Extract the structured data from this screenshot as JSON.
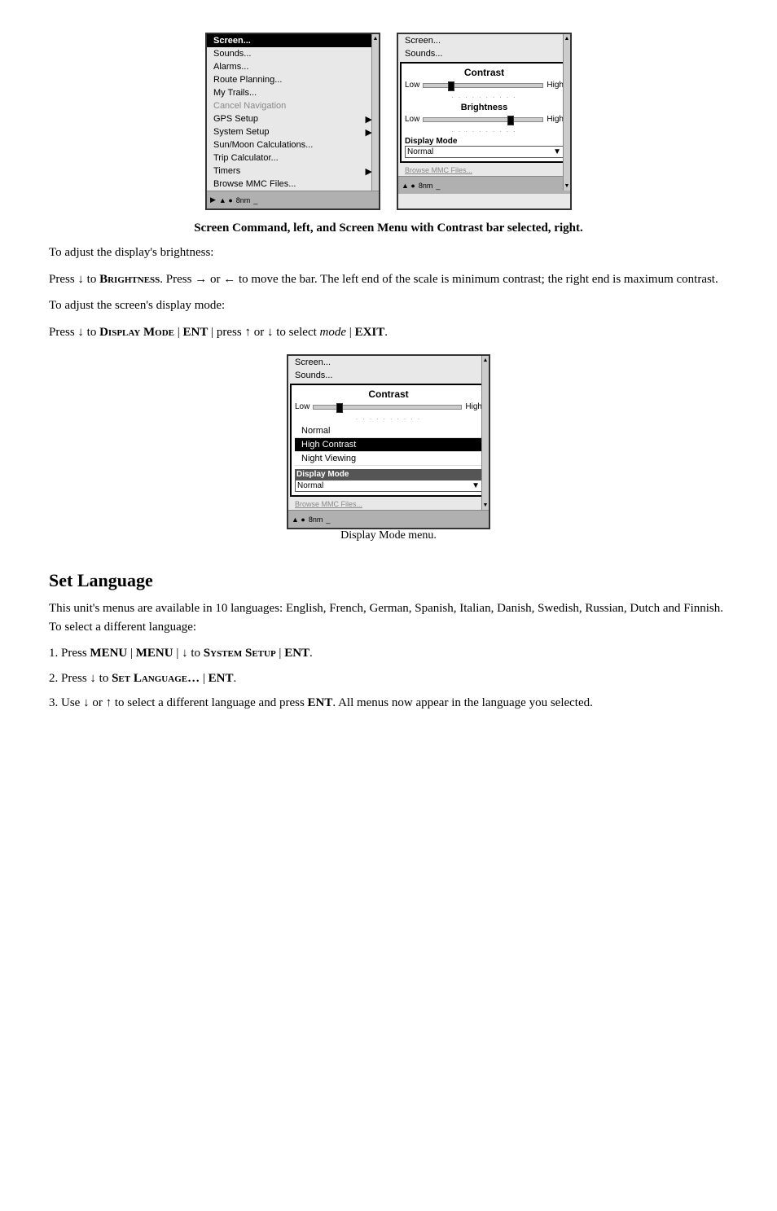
{
  "screenshots": {
    "left_screen": {
      "menu_items": [
        {
          "label": "Screen...",
          "style": "header-like"
        },
        {
          "label": "Sounds...",
          "style": "normal"
        },
        {
          "label": "Alarms...",
          "style": "normal"
        },
        {
          "label": "Route Planning...",
          "style": "normal"
        },
        {
          "label": "My Trails...",
          "style": "normal"
        },
        {
          "label": "Cancel Navigation",
          "style": "disabled"
        },
        {
          "label": "GPS Setup",
          "style": "submenu"
        },
        {
          "label": "System Setup",
          "style": "submenu"
        },
        {
          "label": "Sun/Moon Calculations...",
          "style": "normal"
        },
        {
          "label": "Trip Calculator...",
          "style": "normal"
        },
        {
          "label": "Timers",
          "style": "submenu"
        },
        {
          "label": "Browse MMC Files...",
          "style": "normal"
        }
      ],
      "bottom_label": "8nm"
    },
    "right_screen": {
      "menu_items": [
        {
          "label": "Screen...",
          "style": "normal"
        },
        {
          "label": "Sounds...",
          "style": "normal"
        }
      ],
      "panel_title": "Screen",
      "contrast_label": "Contrast",
      "low_label": "Low",
      "high_label": "High",
      "brightness_label": "Brightness",
      "display_mode_label": "Display Mode",
      "display_mode_value": "Normal",
      "browse_label": "Browse MMC Files...",
      "bottom_label": "8nm"
    }
  },
  "caption_main": "Screen Command, left, and Screen Menu with Contrast bar selected, right.",
  "para1": "To adjust the display's brightness:",
  "para2_prefix": "Press ",
  "para2_down": "↓",
  "para2_text1": " to ",
  "para2_brightness": "Brightness",
  "para2_text2": ". Press ",
  "para2_right": "→",
  "para2_or": " or ",
  "para2_left": "←",
  "para2_text3": " to move the bar. The left end of the scale is minimum contrast; the right end is maximum contrast.",
  "para3": "To adjust the screen's display mode:",
  "para4_prefix": "Press ",
  "para4_down": "↓",
  "para4_text1": " to ",
  "para4_display_mode": "Display Mode",
  "para4_pipe1": " | ",
  "para4_ent": "ENT",
  "para4_pipe2": " | press ",
  "para4_up": "↑",
  "para4_or": " or ",
  "para4_down2": "↓",
  "para4_text2": " to select ",
  "para4_mode_italic": "mode",
  "para4_pipe3": " | ",
  "para4_exit": "EXIT",
  "para4_period": ".",
  "display_mode_screen": {
    "menu_items": [
      {
        "label": "Screen...",
        "style": "normal"
      },
      {
        "label": "Sounds...",
        "style": "normal"
      }
    ],
    "panel_title": "Screen",
    "contrast_label": "Contrast",
    "low_label": "Low",
    "high_label": "High",
    "mode_list": [
      {
        "label": "Normal",
        "selected": false
      },
      {
        "label": "High Contrast",
        "selected": false
      },
      {
        "label": "Night Viewing",
        "selected": false
      }
    ],
    "display_mode_label": "Display Mode",
    "display_mode_value": "Normal",
    "browse_label": "Browse MMC Files...",
    "bottom_label": "8nm"
  },
  "display_mode_caption": "Display Mode menu.",
  "section_title": "Set Language",
  "section_para1": "This unit's menus are available in 10 languages: English, French, German, Spanish, Italian, Danish, Swedish, Russian, Dutch and Finnish. To select a different language:",
  "step1_prefix": "1. Press ",
  "step1_menu1": "MENU",
  "step1_pipe1": " | ",
  "step1_menu2": "MENU",
  "step1_pipe2": " | ",
  "step1_down": "↓",
  "step1_text": " to ",
  "step1_system_setup": "System Setup",
  "step1_pipe3": " | ",
  "step1_ent": "ENT",
  "step1_period": ".",
  "step2_prefix": "2. Press ",
  "step2_down": "↓",
  "step2_text": " to ",
  "step2_set_language": "Set Language…",
  "step2_pipe": " | ",
  "step2_ent": "ENT",
  "step2_period": ".",
  "step3_prefix": "3. Use ",
  "step3_down": "↓",
  "step3_or": " or ",
  "step3_up": "↑",
  "step3_text1": " to select a different language and press ",
  "step3_ent": "ENT",
  "step3_text2": ". All menus now appear in the language you selected."
}
